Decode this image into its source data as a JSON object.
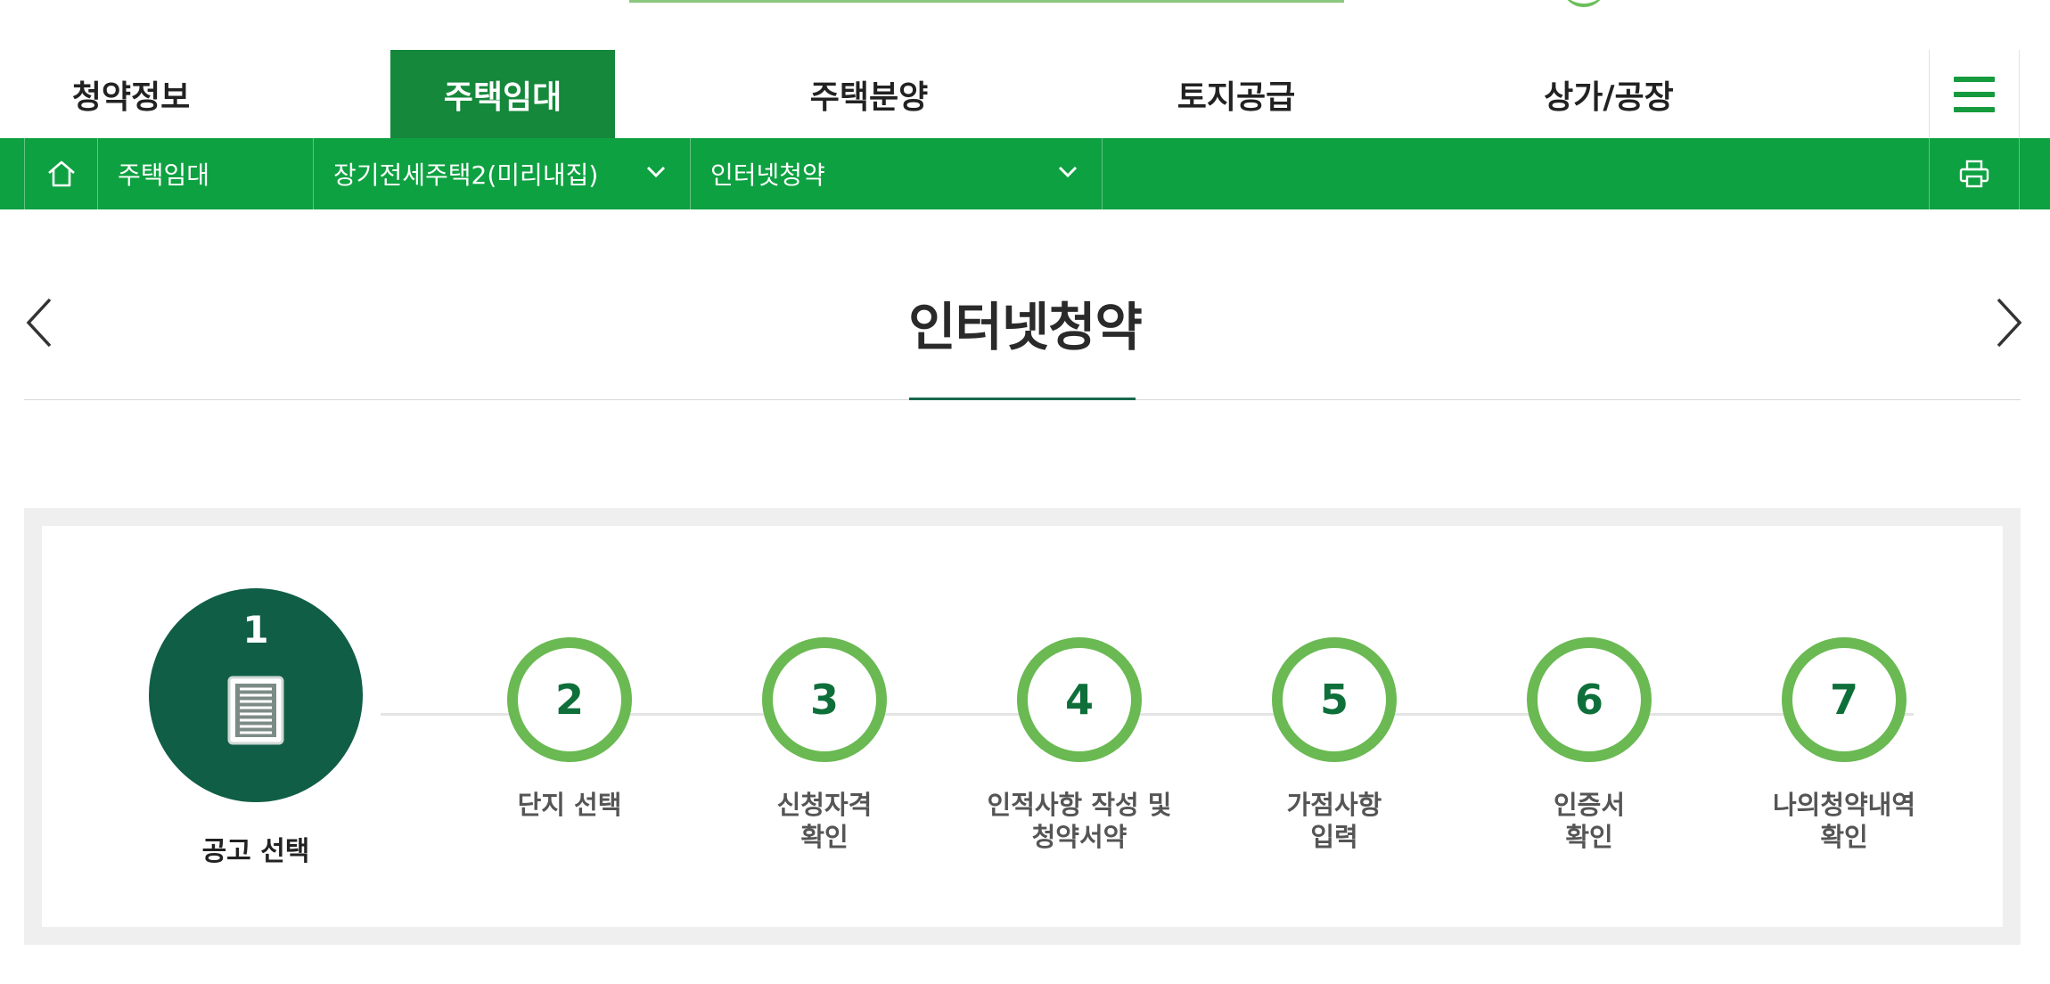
{
  "gnb": {
    "items": [
      {
        "label": "청약정보",
        "active": false
      },
      {
        "label": "주택임대",
        "active": true
      },
      {
        "label": "주택분양",
        "active": false
      },
      {
        "label": "토지공급",
        "active": false
      },
      {
        "label": "상가/공장",
        "active": false
      }
    ],
    "menu_icon": "hamburger-icon"
  },
  "location": {
    "home_icon": "home-icon",
    "depth1": "주택임대",
    "depth2": "장기전세주택2(미리내집)",
    "depth3": "인터넷청약",
    "print_icon": "printer-icon"
  },
  "page": {
    "title": "인터넷청약",
    "prev_icon": "chevron-left-icon",
    "next_icon": "chevron-right-icon"
  },
  "steps": {
    "current": {
      "num": "1",
      "label": "공고 선택",
      "icon": "document-icon"
    },
    "items": [
      {
        "num": "2",
        "label": "단지 선택"
      },
      {
        "num": "3",
        "label": "신청자격\n확인"
      },
      {
        "num": "4",
        "label": "인적사항 작성 및\n청약서약"
      },
      {
        "num": "5",
        "label": "가점사항\n입력"
      },
      {
        "num": "6",
        "label": "인증서\n확인"
      },
      {
        "num": "7",
        "label": "나의청약내역\n확인"
      }
    ]
  },
  "colors": {
    "primary_green": "#0ea141",
    "active_tab_green": "#15883b",
    "dark_green": "#115e47",
    "ring_green": "#6ab953"
  }
}
